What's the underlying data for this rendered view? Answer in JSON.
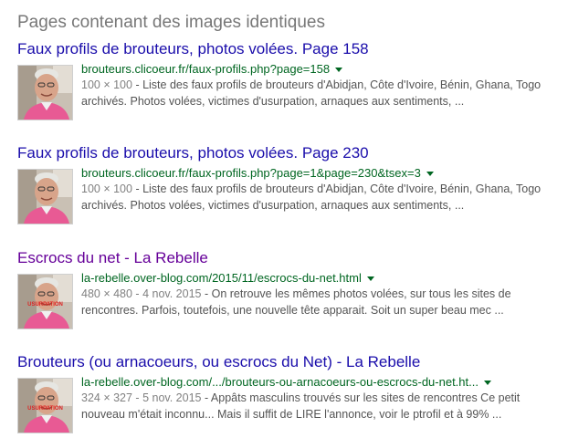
{
  "section_title": "Pages contenant des images identiques",
  "results": [
    {
      "title": "Faux profils de brouteurs, photos volées. Page 158",
      "url": "brouteurs.clicoeur.fr/faux-profils.php?page=158",
      "meta": "100 × 100",
      "snippet_line1": " - Liste des faux profils de brouteurs d'Abidjan, Côte d'Ivoire, Bénin, Ghana, Togo",
      "snippet_line2": "archivés. Photos volées, victimes d'usurpation, arnaques aux sentiments, ...",
      "thumb_stamp": ""
    },
    {
      "title": "Faux profils de brouteurs, photos volées. Page 230",
      "url": "brouteurs.clicoeur.fr/faux-profils.php?page=1&page=230&tsex=3",
      "meta": "100 × 100",
      "snippet_line1": " - Liste des faux profils de brouteurs d'Abidjan, Côte d'Ivoire, Bénin, Ghana, Togo",
      "snippet_line2": "archivés. Photos volées, victimes d'usurpation, arnaques aux sentiments, ...",
      "thumb_stamp": ""
    },
    {
      "title": "Escrocs du net - La Rebelle",
      "url": "la-rebelle.over-blog.com/2015/11/escrocs-du-net.html",
      "meta": "480 × 480 - 4 nov. 2015",
      "snippet_line1": " - On retrouve les mêmes photos volées, sur tous les sites de",
      "snippet_line2": "rencontres. Parfois, toutefois, une nouvelle tête apparait. Soit un super beau mec ...",
      "thumb_stamp": "USURPATION"
    },
    {
      "title": "Brouteurs (ou arnacoeurs, ou escrocs du Net) - La Rebelle",
      "url": "la-rebelle.over-blog.com/.../brouteurs-ou-arnacoeurs-ou-escrocs-du-net.ht...",
      "meta": "324 × 327 - 5 nov. 2015",
      "snippet_line1": " - Appâts masculins trouvés sur les sites de rencontres Ce petit",
      "snippet_line2": "nouveau m'était inconnu... Mais il suffit de LIRE l'annonce, voir le ptrofil et à 99% ...",
      "thumb_stamp": "USURPATION"
    }
  ],
  "colors": {
    "link": "#1a0dab",
    "visited_link": "#660099",
    "url": "#006621",
    "snippet": "#545454",
    "meta": "#808080",
    "section_title": "#777777"
  },
  "icons": {
    "url_menu": "dropdown-caret-icon",
    "thumbnail": "portrait-thumbnail"
  }
}
